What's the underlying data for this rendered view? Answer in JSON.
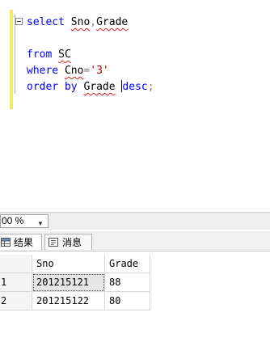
{
  "editor": {
    "lines": [
      {
        "parts": [
          {
            "t": "select",
            "c": "kw"
          },
          {
            "t": " ",
            "c": "id"
          },
          {
            "t": "Sno",
            "c": "id",
            "sq": true
          },
          {
            "t": ",",
            "c": "gr"
          },
          {
            "t": "Grade",
            "c": "id",
            "sq": true
          }
        ]
      },
      {
        "parts": []
      },
      {
        "parts": [
          {
            "t": "from",
            "c": "kw"
          },
          {
            "t": " ",
            "c": "id"
          },
          {
            "t": "SC",
            "c": "id",
            "sq": true
          }
        ]
      },
      {
        "parts": [
          {
            "t": "where",
            "c": "kw"
          },
          {
            "t": " ",
            "c": "id"
          },
          {
            "t": "Cno",
            "c": "id",
            "sq": true
          },
          {
            "t": "=",
            "c": "gr"
          },
          {
            "t": "'3'",
            "c": "st"
          }
        ]
      },
      {
        "parts": [
          {
            "t": "order by",
            "c": "kw"
          },
          {
            "t": " ",
            "c": "id"
          },
          {
            "t": "Grade",
            "c": "id",
            "sq": true
          },
          {
            "t": " ",
            "c": "id"
          },
          {
            "t": "caret",
            "c": "caret"
          },
          {
            "t": "desc",
            "c": "kw"
          },
          {
            "t": ";",
            "c": "gr"
          }
        ]
      }
    ]
  },
  "zoom": {
    "value": "00 %"
  },
  "tabs": [
    {
      "label": "结果",
      "icon": "grid-icon",
      "active": true
    },
    {
      "label": "消息",
      "icon": "message-icon",
      "active": false
    }
  ],
  "results": {
    "columns": [
      "Sno",
      "Grade"
    ],
    "rows": [
      {
        "num": "1",
        "Sno": "201215121",
        "Grade": "88"
      },
      {
        "num": "2",
        "Sno": "201215122",
        "Grade": "80"
      }
    ]
  }
}
